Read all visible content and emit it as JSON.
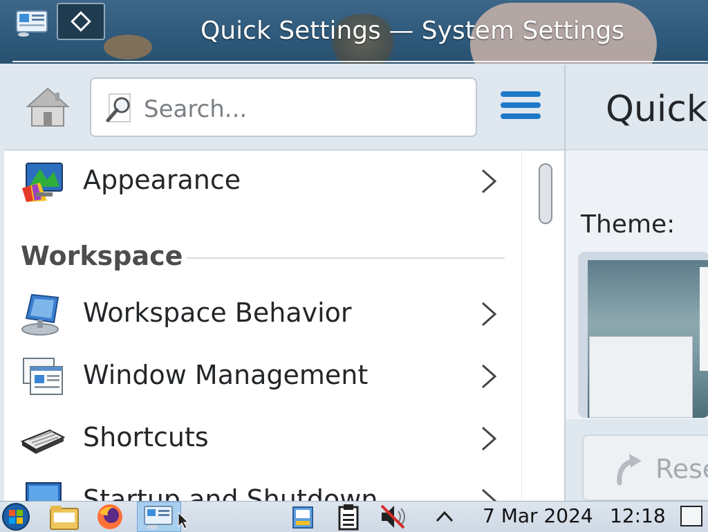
{
  "window": {
    "title": "Quick Settings — System Settings"
  },
  "search": {
    "placeholder": "Search..."
  },
  "sidebar": {
    "items": [
      {
        "label": "Appearance",
        "icon": "appearance-icon"
      },
      {
        "label": "Workspace Behavior",
        "icon": "workspace-behavior-icon"
      },
      {
        "label": "Window Management",
        "icon": "window-management-icon"
      },
      {
        "label": "Shortcuts",
        "icon": "keyboard-icon"
      },
      {
        "label": "Startup and Shutdown",
        "icon": "startup-shutdown-icon"
      }
    ],
    "section_label": "Workspace"
  },
  "main": {
    "title": "Quick",
    "theme_label": "Theme:",
    "reset_label": "Rese"
  },
  "taskbar": {
    "date": "7 Mar 2024",
    "time": "12:18"
  },
  "colors": {
    "accent": "#1f78c8",
    "titlebar": "#2f5a7c",
    "text": "#232629"
  }
}
